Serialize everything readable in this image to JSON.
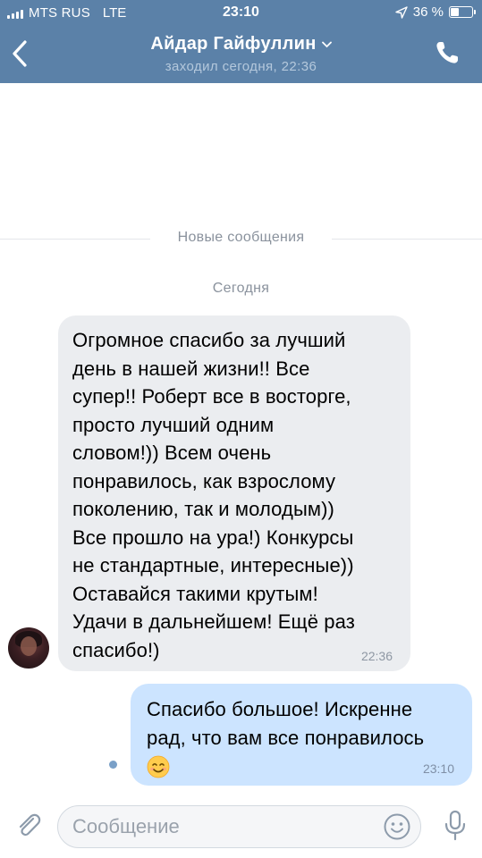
{
  "status_bar": {
    "carrier": "MTS RUS",
    "network": "LTE",
    "time": "23:10",
    "battery": "36 %",
    "battery_level": 0.36
  },
  "header": {
    "contact_name": "Айдар Гайфуллин",
    "last_seen": "заходил сегодня, 22:36",
    "background_color": "#5b81a8"
  },
  "dividers": {
    "new_messages": "Новые сообщения",
    "date": "Сегодня"
  },
  "messages": [
    {
      "direction": "incoming",
      "text": "Огромное спасибо за лучший\nдень в нашей жизни!! Все\nсупер!! Роберт все в восторге,\nпросто лучший одним\nсловом!)) Всем очень\nпонравилось, как взрослому\nпоколению, так и молодым))\nВсе прошло на ура!) Конкурсы\nне стандартные, интересные))\nОставайся такими крутым!\nУдачи в дальнейшем! Ещё раз\nспасибо!)",
      "time": "22:36",
      "bubble_color": "#ebedf0"
    },
    {
      "direction": "outgoing",
      "text": "Спасибо большое! Искренне\nрад, что вам все понравилось",
      "emoji": "smiling-face-emoji",
      "time": "23:10",
      "bubble_color": "#cce4ff"
    }
  ],
  "composer": {
    "placeholder": "Сообщение",
    "value": ""
  },
  "icons": {
    "back": "chevron-left-icon",
    "title_dropdown": "chevron-down-icon",
    "call": "phone-icon",
    "attach": "paperclip-icon",
    "emoji": "smiley-icon",
    "mic": "microphone-icon"
  }
}
